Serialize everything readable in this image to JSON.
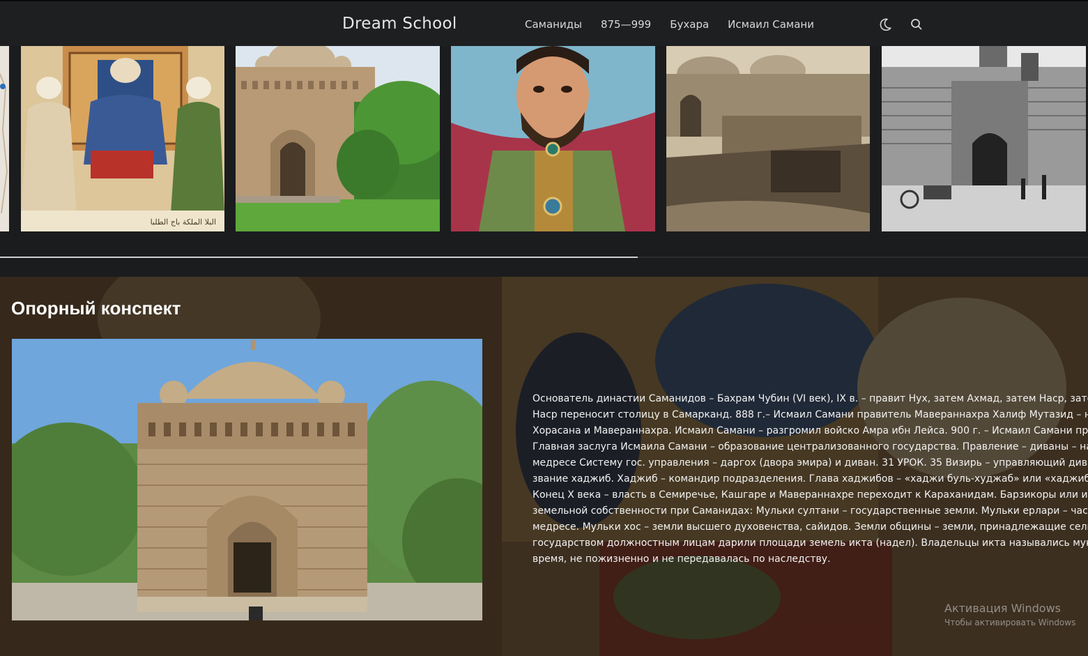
{
  "header": {
    "brand": "Dream School",
    "nav": [
      {
        "label": "Саманиды"
      },
      {
        "label": "875—999"
      },
      {
        "label": "Бухара"
      },
      {
        "label": "Исмаил Самани"
      }
    ],
    "icons": [
      "moon-icon",
      "search-icon"
    ]
  },
  "gallery": {
    "items": [
      {
        "name": "miniature-painting"
      },
      {
        "name": "mausoleum-photo"
      },
      {
        "name": "ismail-samani-portrait"
      },
      {
        "name": "old-bukhara-photo"
      },
      {
        "name": "bukhara-gate-engraving"
      }
    ],
    "progress": 0.586
  },
  "section": {
    "title": "Опорный конспект",
    "text": "Основатель династии Саманидов – Бахрам Чубин (VI век), IX в. – правит Нух, затем Ахмад, затем Наср, затем Исмаил Наср переносит столицу в Самарканд. 888 г.– Исмаил Самани правитель Мавераннахра Халиф Мутазид – назначил А Хорасана и Мавераннахра. Исмаил Самани – разгромил войско Амра ибн Лейса. 900 г. – Исмаил Самани присоединяе Главная заслуга Исмаила Самани – образование централизованного государства. Правление – диваны – на Регистане медресе Систему гос. управления – даргох (двора эмира) и диван. 31 УРОК. 35 Визирь – управляющий диваном. Сарбо звание хаджиб. Хаджиб – командир подразделения. Глава хаджибов – «хаджи буль-худжаб» или «хаджиби бузрук». Хаі Конец X века – власть в Семиречье, Кашгаре и Мавераннахре переходит к Караханидам. Барзикоры или издольщикам земельной собственности при Саманидах: Мульки султани – государственные земли. Мульки ерлари – частные земли. медресе. Мульки хос – земли высшего духовенства, сайидов. Земли общины – земли, принадлежащие сельским общин государством должностным лицам дарили площади земель икта (надел). Владельцы икта назывались мукта или иктад время, не пожизненно и не передавалась по наследству.",
    "lines": [
      "Основатель династии Саманидов – Бахрам Чубин (VI век), IX в. – правит Нух, затем Ахмад, затем Наср, затем Исмаил",
      "Наср переносит столицу в Самарканд. 888 г.– Исмаил Самани правитель Мавераннахра Халиф Мутазид – назначил А",
      "Хорасана и Мавераннахра. Исмаил Самани – разгромил войско Амра ибн Лейса. 900 г. – Исмаил Самани присоединяе",
      "Главная заслуга Исмаила Самани – образование централизованного государства. Правление – диваны – на Регистане",
      "медресе Систему гос. управления – даргох (двора эмира) и диван. 31 УРОК. 35 Визирь – управляющий диваном. Сарбо",
      "звание хаджиб. Хаджиб – командир подразделения. Глава хаджибов – «хаджи буль-худжаб» или «хаджиби бузрук». Хаі",
      "Конец X века – власть в Семиречье, Кашгаре и Мавераннахре переходит к Караханидам. Барзикоры или издольщикам",
      "земельной собственности при Саманидах: Мульки султани – государственные земли. Мульки ерлари – частные земли.",
      "медресе. Мульки хос – земли высшего духовенства, сайидов. Земли общины – земли, принадлежащие сельским общин",
      "государством должностным лицам дарили площади земель икта (надел). Владельцы икта назывались мукта или иктад",
      "время, не пожизненно и не передавалась по наследству."
    ]
  },
  "windows_watermark": {
    "title": "Активация Windows",
    "subtitle": "Чтобы активировать Windows"
  },
  "colors": {
    "header_bg": "#1e1f21",
    "page_bg": "#1b1c1e",
    "sky": "#6fa6dc",
    "brick": "#b59a78"
  }
}
